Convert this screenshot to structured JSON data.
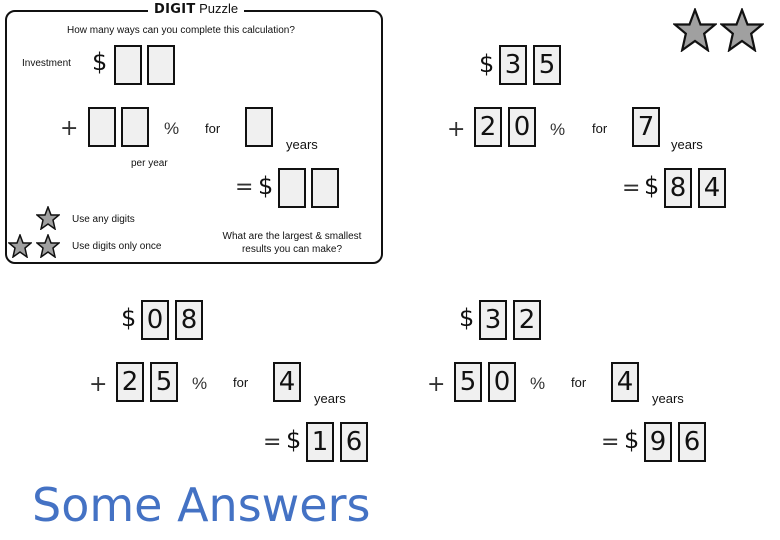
{
  "puzzle": {
    "title_bold": "DIGIT",
    "title_rest": "Puzzle",
    "question": "How many ways can you complete this calculation?",
    "investment_label": "Investment",
    "dollar": "$",
    "plus": "+",
    "percent": "%",
    "for": "for",
    "years": "years",
    "per_year": "per year",
    "equals": "=",
    "rule_one_star": "Use any digits",
    "rule_two_stars": "Use digits only once",
    "challenge": "What are the largest & smallest results you can make?",
    "star_color": "#a0a0a0"
  },
  "answers_title": "Some Answers",
  "answers": [
    {
      "investment": [
        "3",
        "5"
      ],
      "rate": [
        "2",
        "0"
      ],
      "years": "7",
      "result": [
        "8",
        "4"
      ]
    },
    {
      "investment": [
        "0",
        "8"
      ],
      "rate": [
        "2",
        "5"
      ],
      "years": "4",
      "result": [
        "1",
        "6"
      ]
    },
    {
      "investment": [
        "3",
        "2"
      ],
      "rate": [
        "5",
        "0"
      ],
      "years": "4",
      "result": [
        "9",
        "6"
      ]
    }
  ]
}
